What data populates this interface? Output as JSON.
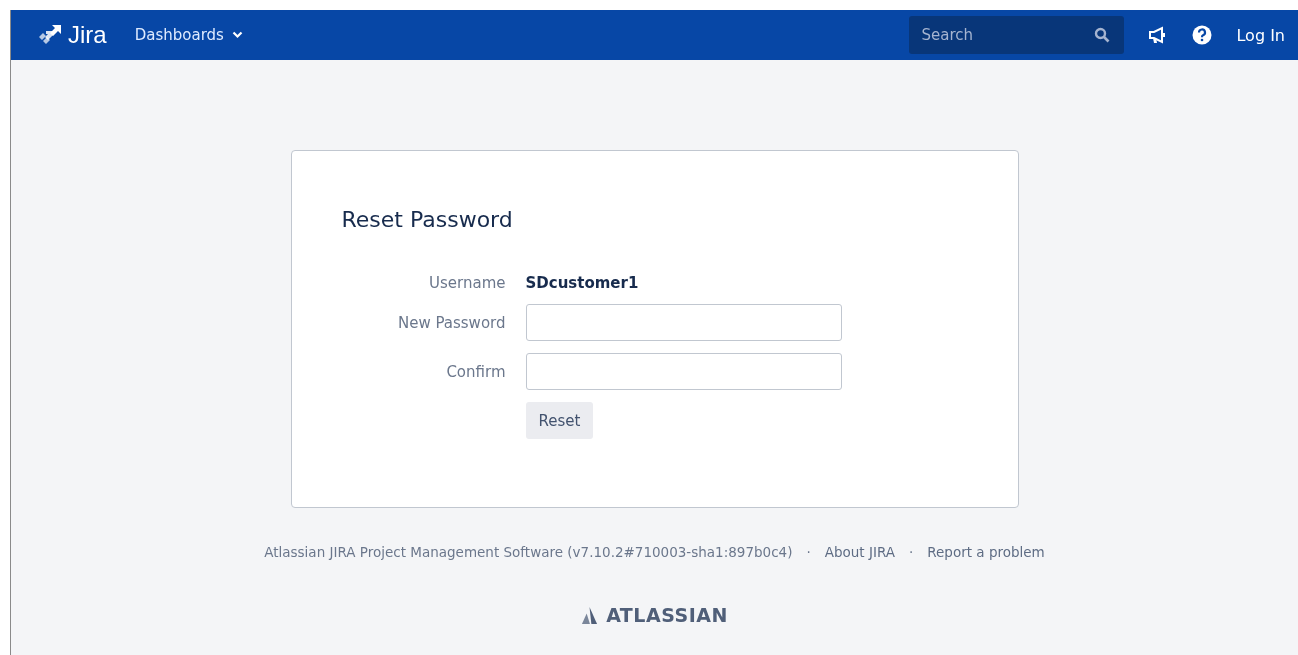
{
  "header": {
    "logo": "Jira",
    "menu": {
      "label": "Dashboards"
    },
    "search": {
      "placeholder": "Search"
    },
    "login": "Log In"
  },
  "form": {
    "title": "Reset Password",
    "fields": [
      {
        "kind": "readonly",
        "label": "Username",
        "value": "SDcustomer1"
      },
      {
        "kind": "password",
        "label": "New Password"
      },
      {
        "kind": "password",
        "label": "Confirm"
      }
    ],
    "button": "Reset"
  },
  "footer": [
    {
      "kind": "text",
      "text": "Atlassian JIRA Project Management Software (v7.10.2#710003-sha1:897b0c4)"
    },
    {
      "kind": "separator",
      "text": "·"
    },
    {
      "kind": "link",
      "text": "About JIRA"
    },
    {
      "kind": "separator",
      "text": "·"
    },
    {
      "kind": "link",
      "text": "Report a problem"
    }
  ],
  "brand": "ATLASSIAN"
}
